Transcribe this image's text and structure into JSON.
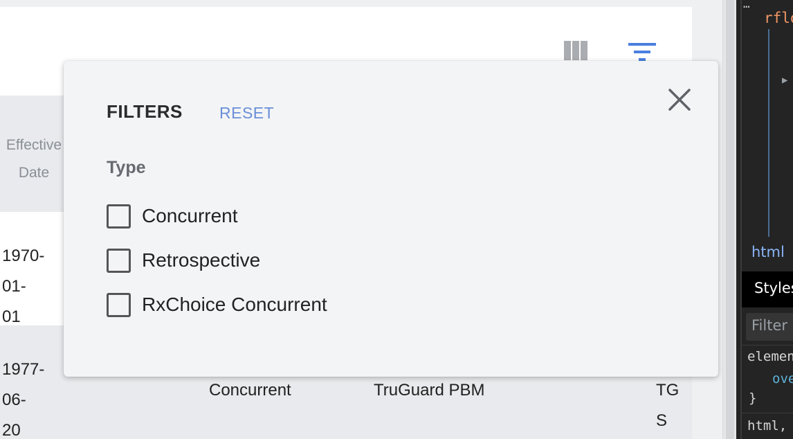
{
  "toolbar": {
    "columns_icon": "columns-icon",
    "filter_icon": "filter-icon",
    "accent_color": "#4a7fe0"
  },
  "table": {
    "columns": {
      "effective_date": "Effective\nDate"
    },
    "rows": [
      {
        "effective_date": "1970-01-\n01",
        "type": "",
        "pbm": "",
        "code": ""
      },
      {
        "effective_date": "1977-06-\n20",
        "type": "Concurrent",
        "pbm": "TruGuard PBM",
        "code": "TG S"
      }
    ]
  },
  "filters_panel": {
    "title": "FILTERS",
    "reset_label": "RESET",
    "close_icon": "close-icon",
    "group_label": "Type",
    "options": [
      {
        "label": "Concurrent",
        "checked": false
      },
      {
        "label": "Retrospective",
        "checked": false
      },
      {
        "label": "RxChoice Concurrent",
        "checked": false
      }
    ]
  },
  "devtools": {
    "breadcrumb_dots": "…",
    "attr_fragment": "rflo",
    "html_crumb": "html",
    "styles_tab": "Styles",
    "filter_placeholder": "Filter",
    "code_line1": "elemen",
    "code_line2": "ove",
    "code_line3": "}",
    "code_line4": "html,"
  }
}
